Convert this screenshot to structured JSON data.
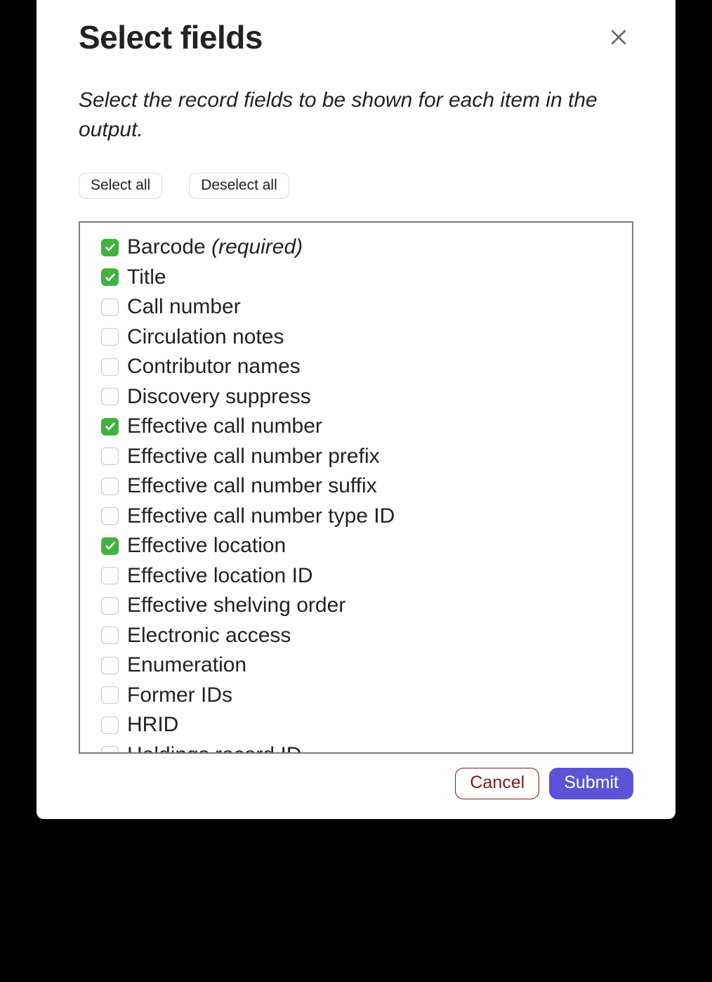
{
  "dialog": {
    "title": "Select fields",
    "description": "Select the record fields to be shown for each item in the output.",
    "required_note": "(required)"
  },
  "toolbar": {
    "selectAll": "Select all",
    "deselectAll": "Deselect all"
  },
  "fields": [
    {
      "label": "Barcode",
      "checked": true,
      "required": true
    },
    {
      "label": "Title",
      "checked": true,
      "required": false
    },
    {
      "label": "Call number",
      "checked": false,
      "required": false
    },
    {
      "label": "Circulation notes",
      "checked": false,
      "required": false
    },
    {
      "label": "Contributor names",
      "checked": false,
      "required": false
    },
    {
      "label": "Discovery suppress",
      "checked": false,
      "required": false
    },
    {
      "label": "Effective call number",
      "checked": true,
      "required": false
    },
    {
      "label": "Effective call number prefix",
      "checked": false,
      "required": false
    },
    {
      "label": "Effective call number suffix",
      "checked": false,
      "required": false
    },
    {
      "label": "Effective call number type ID",
      "checked": false,
      "required": false
    },
    {
      "label": "Effective location",
      "checked": true,
      "required": false
    },
    {
      "label": "Effective location ID",
      "checked": false,
      "required": false
    },
    {
      "label": "Effective shelving order",
      "checked": false,
      "required": false
    },
    {
      "label": "Electronic access",
      "checked": false,
      "required": false
    },
    {
      "label": "Enumeration",
      "checked": false,
      "required": false
    },
    {
      "label": "Former IDs",
      "checked": false,
      "required": false
    },
    {
      "label": "HRID",
      "checked": false,
      "required": false
    },
    {
      "label": "Holdings record ID",
      "checked": false,
      "required": false
    }
  ],
  "footer": {
    "cancel": "Cancel",
    "submit": "Submit"
  }
}
